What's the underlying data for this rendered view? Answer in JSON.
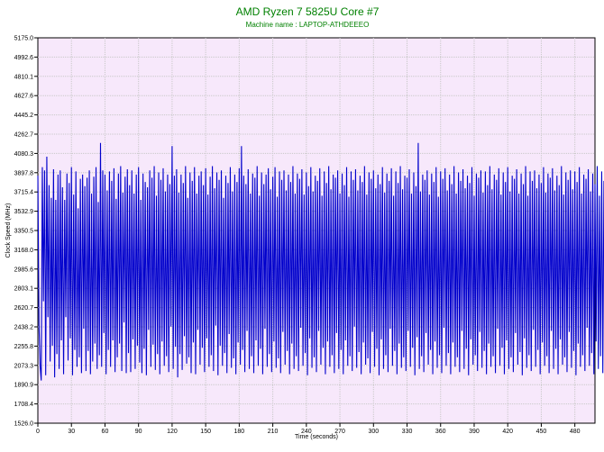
{
  "chart_data": {
    "type": "line",
    "title": "AMD Ryzen 7 5825U Core #7",
    "subtitle": "Machine name : LAPTOP-ATHDEEEO",
    "xlabel": "Time (seconds)",
    "ylabel": "Clock Speed (MHz)",
    "xlim": [
      0,
      498
    ],
    "ylim": [
      1526.0,
      5175.0
    ],
    "x_ticks": [
      0,
      30,
      60,
      90,
      120,
      150,
      180,
      210,
      240,
      270,
      300,
      330,
      360,
      390,
      420,
      450,
      480
    ],
    "y_ticks": [
      "1526.0",
      "1708.4",
      "1890.9",
      "2073.3",
      "2255.8",
      "2438.2",
      "2620.7",
      "2803.1",
      "2985.6",
      "3168.0",
      "3350.5",
      "3532.9",
      "3715.4",
      "3897.8",
      "4080.3",
      "4262.7",
      "4445.2",
      "4627.6",
      "4810.1",
      "4992.6",
      "5175.0"
    ],
    "grid": true,
    "legend": "none",
    "colors": {
      "plot_background": "#f7e8fb",
      "grid": "#c8c8c8",
      "series": "#0000cc",
      "title": "#008000",
      "subtitle": "#008000"
    },
    "series": [
      {
        "name": "",
        "x_start": 0,
        "x_step": 1,
        "values": [
          3870,
          2460,
          2070,
          1930,
          3950,
          2680,
          3920,
          1980,
          4050,
          2530,
          3780,
          2110,
          3660,
          2260,
          3930,
          1960,
          3640,
          2180,
          3880,
          2040,
          3920,
          2310,
          3760,
          1990,
          3640,
          2530,
          3890,
          2120,
          3800,
          2330,
          3950,
          1980,
          3690,
          2220,
          3910,
          2060,
          3560,
          2150,
          3840,
          2000,
          3880,
          2420,
          3770,
          2020,
          3850,
          2210,
          3920,
          1990,
          3700,
          2110,
          3860,
          2280,
          3950,
          2040,
          3620,
          2170,
          4180,
          2060,
          3920,
          2380,
          3880,
          1990,
          3730,
          2220,
          3910,
          2060,
          3820,
          2310,
          3940,
          2010,
          3650,
          2150,
          3890,
          2280,
          3960,
          2020,
          3710,
          2480,
          3860,
          2000,
          3930,
          2190,
          3780,
          2010,
          3920,
          2320,
          3700,
          2040,
          3880,
          2260,
          3950,
          2100,
          3640,
          2000,
          3890,
          2230,
          3810,
          1980,
          3760,
          2410,
          3920,
          2060,
          3850,
          2270,
          3960,
          2030,
          3680,
          2180,
          3900,
          1990,
          3830,
          2300,
          3940,
          2070,
          3720,
          2160,
          3880,
          2010,
          3790,
          2440,
          4150,
          2040,
          3870,
          2250,
          3930,
          1960,
          3710,
          2180,
          3880,
          2030,
          3800,
          2350,
          3960,
          2090,
          3660,
          2150,
          3900,
          2000,
          3820,
          2290,
          3950,
          1990,
          3700,
          2410,
          3870,
          2080,
          3910,
          2240,
          3780,
          2010,
          3940,
          2330,
          3690,
          2060,
          3860,
          2170,
          3960,
          2020,
          3750,
          2450,
          3900,
          1980,
          3830,
          2260,
          3920,
          2070,
          3660,
          2190,
          3870,
          2000,
          3800,
          2370,
          3950,
          2050,
          3720,
          2140,
          3880,
          1990,
          3810,
          2290,
          3940,
          2080,
          4150,
          2220,
          3870,
          2010,
          3790,
          2400,
          3930,
          2040,
          3700,
          2160,
          3890,
          2000,
          3850,
          2310,
          3960,
          2070,
          3680,
          2230,
          3900,
          1990,
          3790,
          2420,
          3880,
          2060,
          3940,
          2180,
          3740,
          2010,
          3860,
          2300,
          3950,
          2050,
          3670,
          2140,
          3910,
          2000,
          3830,
          2390,
          3920,
          2080,
          3730,
          2210,
          3880,
          1990,
          3810,
          2280,
          3960,
          2040,
          3700,
          2160,
          3890,
          2020,
          3840,
          2430,
          3930,
          2070,
          3690,
          2190,
          3900,
          1980,
          3770,
          2330,
          3950,
          2050,
          3720,
          2150,
          3870,
          2010,
          3820,
          2400,
          3940,
          2080,
          3680,
          2240,
          3910,
          1990,
          3800,
          2300,
          3960,
          2060,
          3740,
          2170,
          3880,
          2000,
          3850,
          2380,
          3920,
          2040,
          3700,
          2220,
          3890,
          1990,
          3780,
          2310,
          3950,
          2070,
          3670,
          2160,
          3910,
          2020,
          3830,
          2440,
          3930,
          2050,
          3730,
          2200,
          3870,
          1990,
          3810,
          2290,
          3960,
          2080,
          3690,
          2140,
          3900,
          2000,
          3840,
          2390,
          3920,
          2060,
          3750,
          2230,
          3880,
          1980,
          3790,
          2320,
          3950,
          2040,
          3710,
          2170,
          3890,
          2010,
          3820,
          2420,
          3940,
          2070,
          3680,
          2210,
          3910,
          1990,
          3800,
          2280,
          3960,
          2050,
          3740,
          2150,
          3870,
          2020,
          3850,
          2400,
          3930,
          2060,
          3700,
          2240,
          3900,
          1980,
          3770,
          2340,
          4180,
          2040,
          3720,
          2160,
          3880,
          2010,
          3830,
          2380,
          3920,
          2080,
          3690,
          2220,
          3890,
          1990,
          3810,
          2300,
          3950,
          2050,
          3670,
          2170,
          3910,
          2000,
          3840,
          2430,
          3940,
          2070,
          3730,
          2190,
          3880,
          1990,
          3790,
          2290,
          3960,
          2060,
          3700,
          2150,
          3900,
          2010,
          3820,
          2400,
          3930,
          2040,
          3750,
          2230,
          3870,
          1980,
          3800,
          2320,
          3950,
          2080,
          3680,
          2170,
          3890,
          2020,
          3850,
          2390,
          3920,
          2050,
          3710,
          2210,
          3910,
          1990,
          3780,
          2280,
          3960,
          2060,
          3740,
          2160,
          3880,
          2000,
          3830,
          2420,
          3940,
          2070,
          3690,
          2240,
          3900,
          1990,
          3810,
          2310,
          3950,
          2040,
          3720,
          2150,
          3870,
          2010,
          3840,
          2380,
          3930,
          2080,
          3700,
          2200,
          3890,
          1980,
          3790,
          2330,
          3960,
          2050,
          3680,
          2170,
          3910,
          2020,
          3820,
          2410,
          3920,
          2060,
          3750,
          2220,
          3880,
          1990,
          3800,
          2290,
          3950,
          2070,
          3710,
          2160,
          3890,
          2000,
          3850,
          2400,
          3940,
          2040,
          3730,
          2230,
          3870,
          1990,
          3780,
          2320,
          3960,
          2080,
          3690,
          2150,
          3900,
          2010,
          3830,
          2390,
          3920,
          2050,
          3740,
          2210,
          3910,
          1980,
          3810,
          2280,
          3950,
          2060,
          3700,
          2170,
          3880,
          2020,
          3840,
          2430,
          3930,
          2070,
          3720,
          2190,
          3890,
          1990,
          3790,
          2300,
          3960,
          2040,
          3680,
          2160,
          3910,
          2000,
          3820,
          2370,
          3940,
          2080,
          3750,
          2240,
          3870
        ]
      }
    ]
  }
}
